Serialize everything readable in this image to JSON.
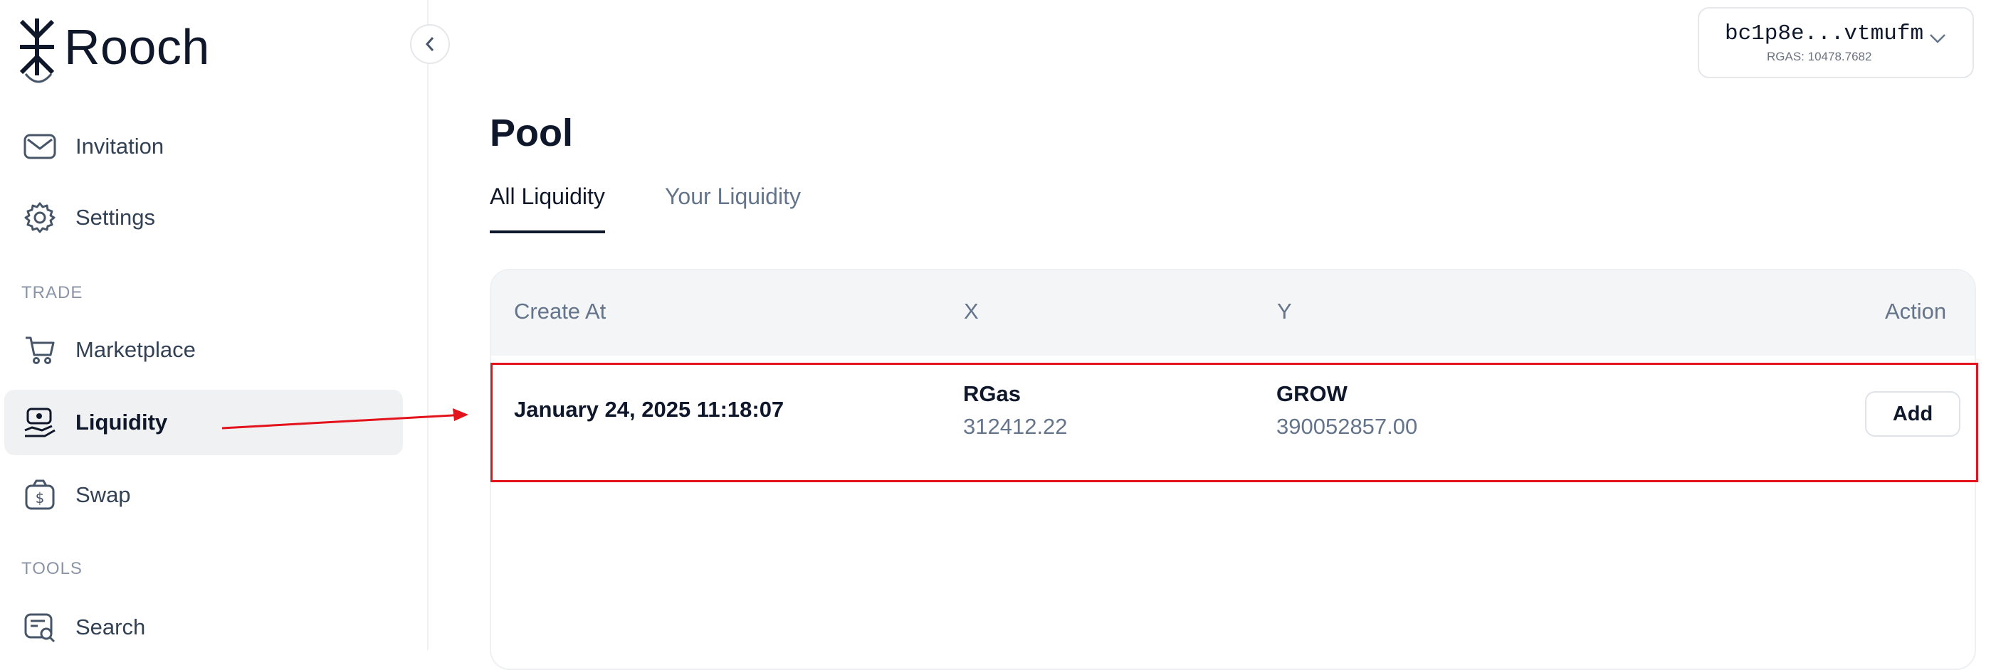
{
  "app": {
    "name": "Rooch"
  },
  "sidebar": {
    "items_top": [
      {
        "label": "Invitation",
        "icon": "mail-icon"
      },
      {
        "label": "Settings",
        "icon": "gear-icon"
      }
    ],
    "sections": [
      {
        "title": "TRADE",
        "items": [
          {
            "label": "Marketplace",
            "icon": "cart-icon"
          },
          {
            "label": "Liquidity",
            "icon": "liquidity-icon",
            "active": true
          },
          {
            "label": "Swap",
            "icon": "swap-icon"
          }
        ]
      },
      {
        "title": "TOOLS",
        "items": [
          {
            "label": "Search",
            "icon": "search-icon"
          }
        ]
      }
    ]
  },
  "account": {
    "address": "bc1p8e...vtmufm",
    "gas": "RGAS: 10478.7682"
  },
  "main": {
    "title": "Pool",
    "tabs": [
      {
        "label": "All Liquidity",
        "active": true
      },
      {
        "label": "Your Liquidity",
        "active": false
      }
    ],
    "table": {
      "headers": [
        "Create At",
        "X",
        "Y",
        "Action"
      ],
      "rows": [
        {
          "created": "January 24, 2025 11:18:07",
          "x_name": "RGas",
          "x_value": "312412.22",
          "y_name": "GROW",
          "y_value": "390052857.00",
          "action": "Add"
        }
      ]
    }
  },
  "colors": {
    "accent": "#0f172a",
    "highlight": "#e3121b",
    "active_bg": "#f0f1f3"
  }
}
